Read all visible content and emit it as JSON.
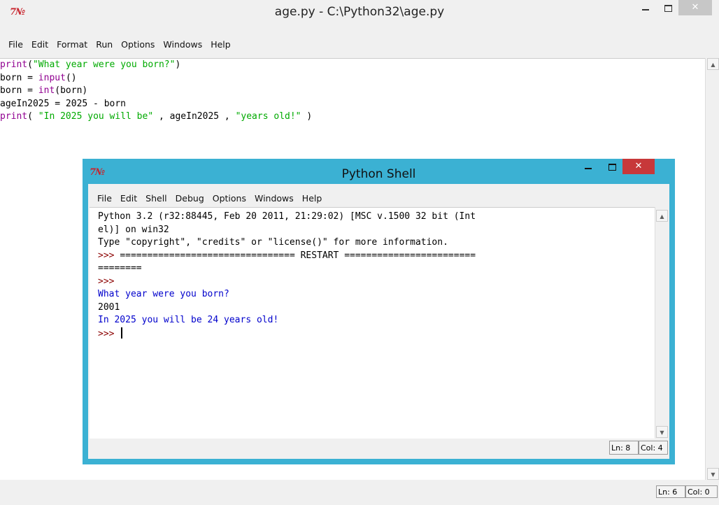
{
  "editor": {
    "logo": "7№",
    "title": "age.py - C:\\Python32\\age.py",
    "menu": [
      "File",
      "Edit",
      "Format",
      "Run",
      "Options",
      "Windows",
      "Help"
    ],
    "code": {
      "line1": {
        "fn": "print",
        "open": "(",
        "str": "\"What year were you born?\"",
        "close": ")"
      },
      "line2": {
        "lhs": "born = ",
        "fn": "input",
        "rest": "()"
      },
      "line3": {
        "lhs": "born = ",
        "fn": "int",
        "rest": "(born)"
      },
      "line4": {
        "text": "ageIn2025 = 2025 - born"
      },
      "line5": {
        "fn": "print",
        "open": "( ",
        "str1": "\"In 2025 you will be\"",
        "mid": " , ageIn2025 , ",
        "str2": "\"years old!\"",
        "close": " )"
      }
    },
    "status": {
      "ln": "Ln: 6",
      "col": "Col: 0"
    },
    "scroll_up": "▲",
    "scroll_down": "▼",
    "minimize_icon": "minimize-icon",
    "maximize_icon": "maximize-icon",
    "close_glyph": "✕"
  },
  "shell": {
    "logo": "7№",
    "title": "Python Shell",
    "menu": [
      "File",
      "Edit",
      "Shell",
      "Debug",
      "Options",
      "Windows",
      "Help"
    ],
    "lines": {
      "l1": "Python 3.2 (r32:88445, Feb 20 2011, 21:29:02) [MSC v.1500 32 bit (Int",
      "l2": "el)] on win32",
      "l3": "Type \"copyright\", \"credits\" or \"license()\" for more information.",
      "l4_prompt": ">>> ",
      "l4_rest": "================================ RESTART ========================",
      "l5": "========",
      "l6_prompt": ">>> ",
      "l7": "What year were you born?",
      "l8": "2001",
      "l9": "In 2025 you will be 24 years old!",
      "l10_prompt": ">>> "
    },
    "status": {
      "ln": "Ln: 8",
      "col": "Col: 4"
    },
    "scroll_up": "▲",
    "scroll_down": "▼",
    "close_glyph": "✕"
  }
}
